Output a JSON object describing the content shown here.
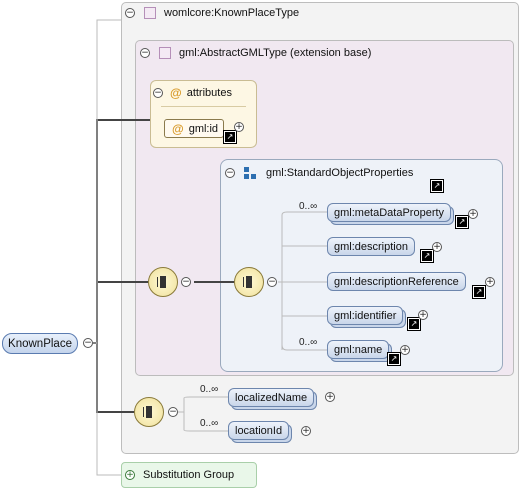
{
  "complex_type": {
    "label": "womlcore:KnownPlaceType"
  },
  "extension": {
    "label": "gml:AbstractGMLType (extension base)"
  },
  "attributes": {
    "label": "attributes",
    "items": [
      {
        "label": "gml:id"
      }
    ]
  },
  "standard_object_properties": {
    "label": "gml:StandardObjectProperties",
    "elements": [
      {
        "label": "gml:metaDataProperty",
        "cardinality": "0..∞"
      },
      {
        "label": "gml:description",
        "cardinality": ""
      },
      {
        "label": "gml:descriptionReference",
        "cardinality": ""
      },
      {
        "label": "gml:identifier",
        "cardinality": ""
      },
      {
        "label": "gml:name",
        "cardinality": "0..∞"
      }
    ]
  },
  "own_sequence": {
    "elements": [
      {
        "label": "localizedName",
        "cardinality": "0..∞"
      },
      {
        "label": "locationId",
        "cardinality": "0..∞"
      }
    ]
  },
  "root": {
    "label": "KnownPlace"
  },
  "substitution_group": {
    "label": "Substitution Group"
  },
  "colors": {
    "element_border": "#6d86ad",
    "attribute_bg": "#fdf7e4",
    "extension_bg": "#f1e8f1",
    "subst_bg": "#e9f7e9"
  }
}
